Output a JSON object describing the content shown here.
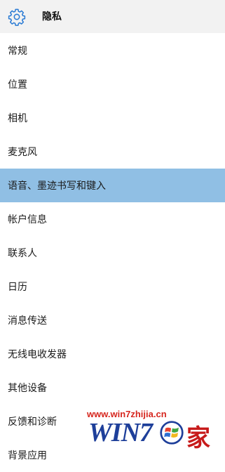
{
  "header": {
    "title": "隐私",
    "icon": "gear-icon"
  },
  "nav": {
    "items": [
      {
        "label": "常规"
      },
      {
        "label": "位置"
      },
      {
        "label": "相机"
      },
      {
        "label": "麦克风"
      },
      {
        "label": "语音、墨迹书写和键入",
        "selected": true
      },
      {
        "label": "帐户信息"
      },
      {
        "label": "联系人"
      },
      {
        "label": "日历"
      },
      {
        "label": "消息传送"
      },
      {
        "label": "无线电收发器"
      },
      {
        "label": "其他设备"
      },
      {
        "label": "反馈和诊断"
      },
      {
        "label": "背景应用"
      }
    ]
  },
  "watermark": {
    "url": "www.win7zhijia.cn",
    "brand": "WIN7",
    "char": "家"
  },
  "colors": {
    "header_bg": "#f2f2f2",
    "selected_bg": "#90bfe4",
    "gear": "#2a7bd4",
    "watermark_red": "#d6261e",
    "watermark_blue": "#1e3f9a"
  }
}
